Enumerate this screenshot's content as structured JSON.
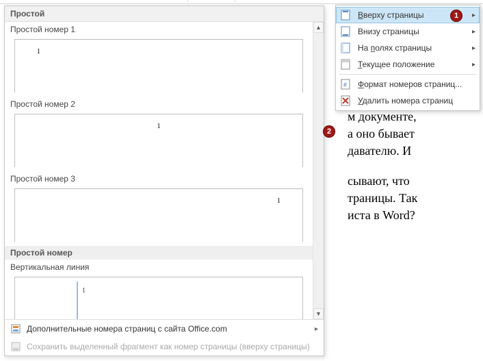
{
  "gallery": {
    "header": "Простой",
    "items": [
      {
        "label": "Простой номер 1",
        "num": "1"
      },
      {
        "label": "Простой номер 2",
        "num": "1"
      },
      {
        "label": "Простой номер 3",
        "num": "1"
      }
    ],
    "sub_header": "Простой номер",
    "sub_item_label": "Вертикальная линия",
    "sub_item_num": "1",
    "footer_more": "Дополнительные номера страниц с сайта Office.com",
    "footer_save": "Сохранить выделенный фрагмент как номер страницы (вверху страницы)"
  },
  "menu": {
    "items": [
      {
        "key": "top",
        "label": "Вверху страницы",
        "arrow": true,
        "u": "В"
      },
      {
        "key": "bottom",
        "label": "Внизу страницы",
        "arrow": true,
        "u": ""
      },
      {
        "key": "margins",
        "label": "На полях страницы",
        "arrow": true,
        "u": "п"
      },
      {
        "key": "current",
        "label": "Текущее положение",
        "arrow": true,
        "u": "Т"
      },
      {
        "key": "format",
        "label": "Формат номеров страниц...",
        "arrow": false,
        "u": "Ф"
      },
      {
        "key": "remove",
        "label": "Удалить номера страниц",
        "arrow": false,
        "u": "У"
      }
    ]
  },
  "doc_lines": [
    "м документе,",
    "а оно бывает",
    "давателю.  И",
    "",
    "сывают,  что",
    "траницы. Так",
    "иста в Word?"
  ],
  "callouts": {
    "one": "1",
    "two": "2"
  }
}
